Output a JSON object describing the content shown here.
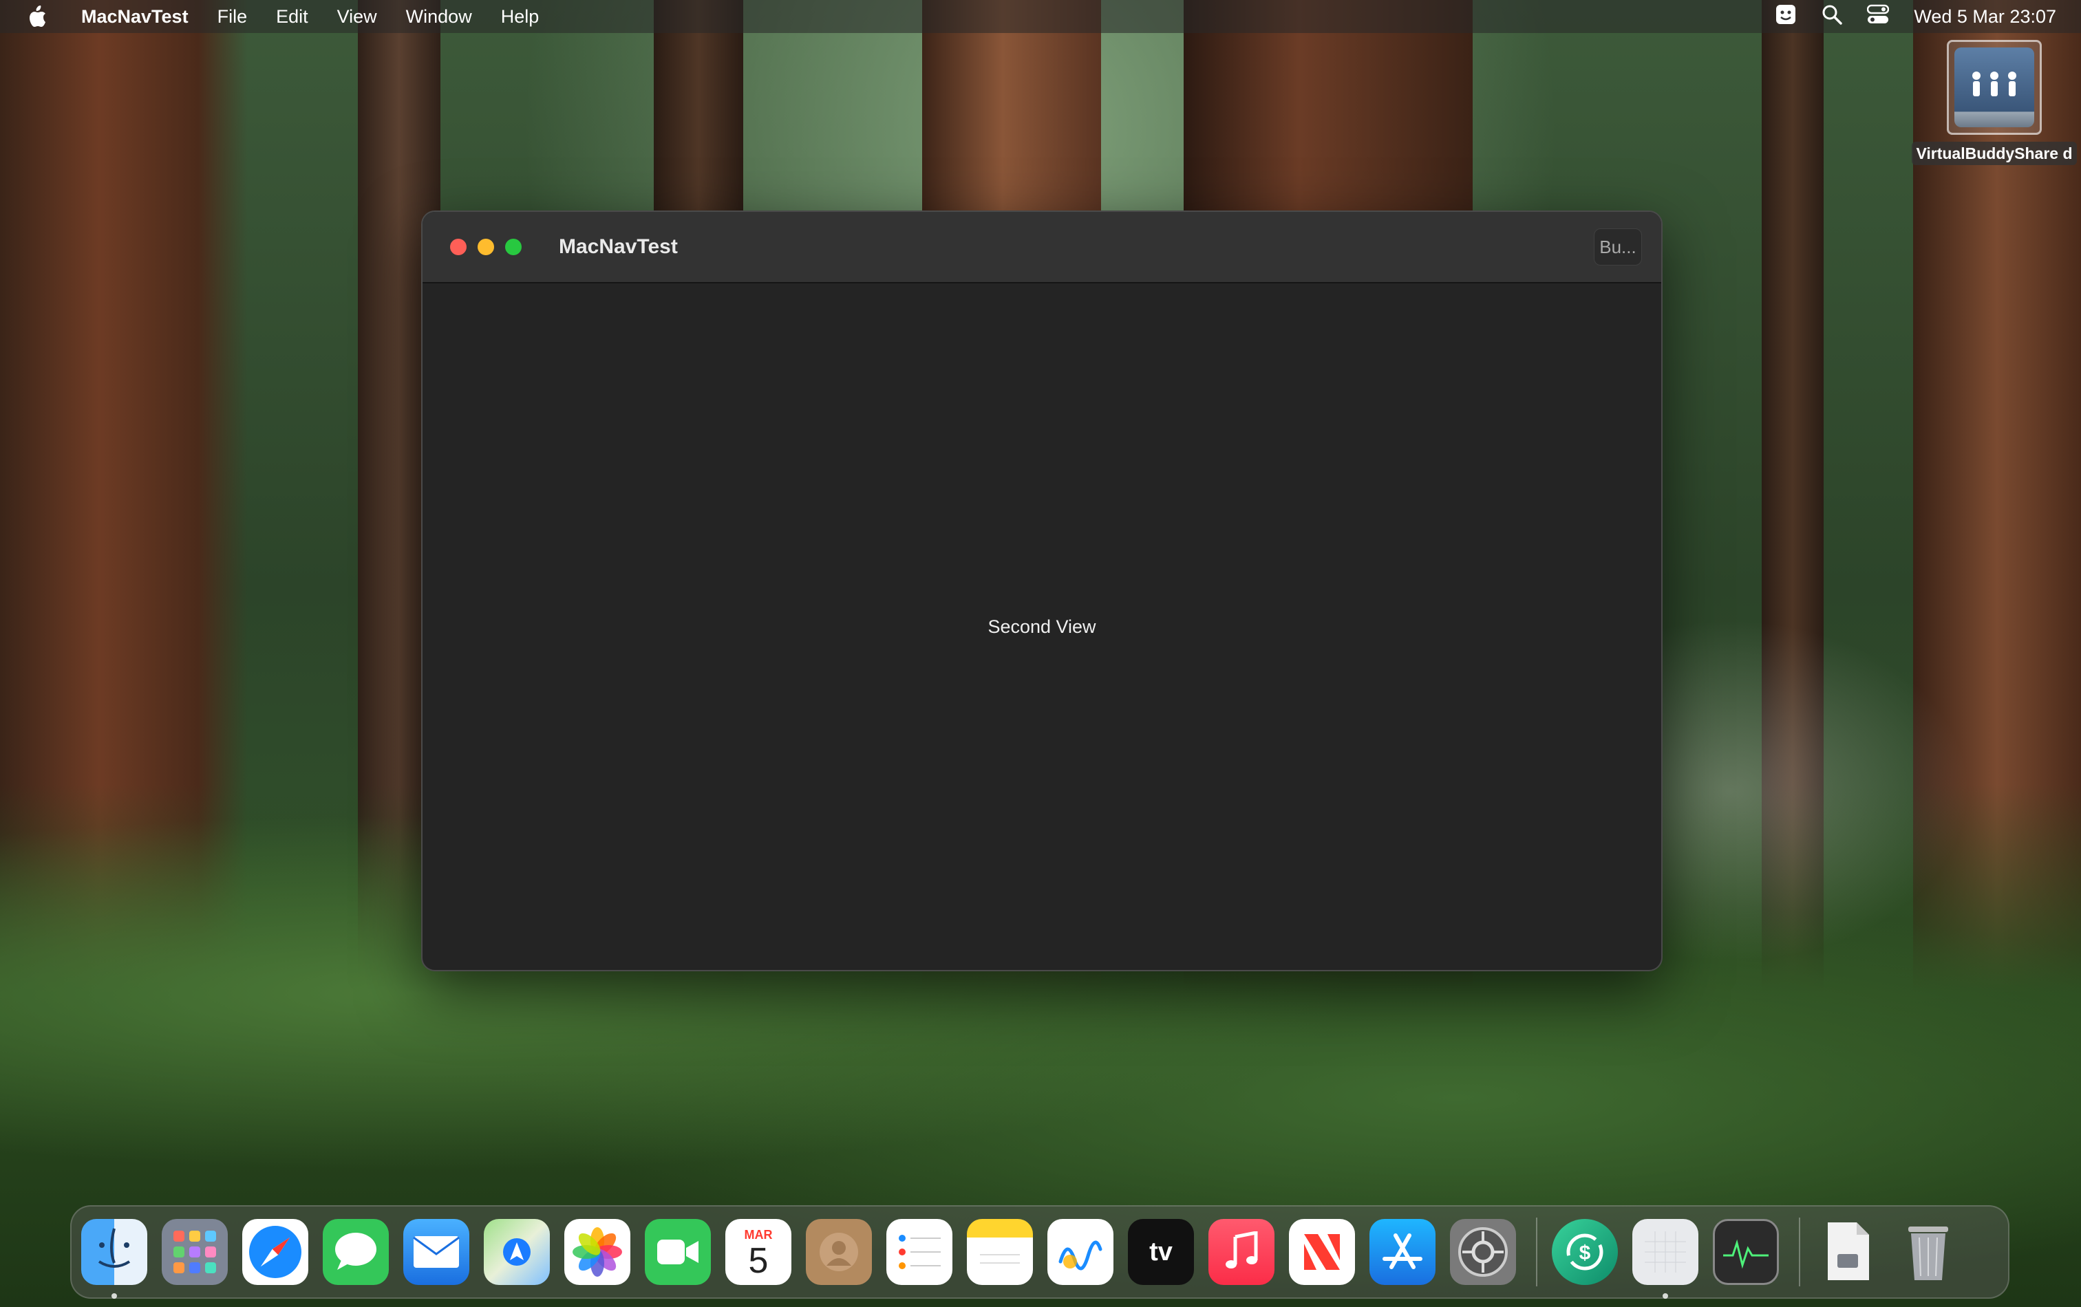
{
  "menubar": {
    "app_name": "MacNavTest",
    "menus": [
      "File",
      "Edit",
      "View",
      "Window",
      "Help"
    ],
    "clock": "Wed 5 Mar  23:07"
  },
  "desktop": {
    "icon_label": "VirtualBuddyShare d"
  },
  "window": {
    "title": "MacNavTest",
    "toolbar_button": "Bu...",
    "content_text": "Second View"
  },
  "dock": {
    "calendar_month": "MAR",
    "calendar_day": "5",
    "tv_label": "tv"
  },
  "colors": {
    "close": "#ff5f57",
    "minimize": "#febc2e",
    "zoom": "#28c840",
    "window_bg": "#242424"
  }
}
